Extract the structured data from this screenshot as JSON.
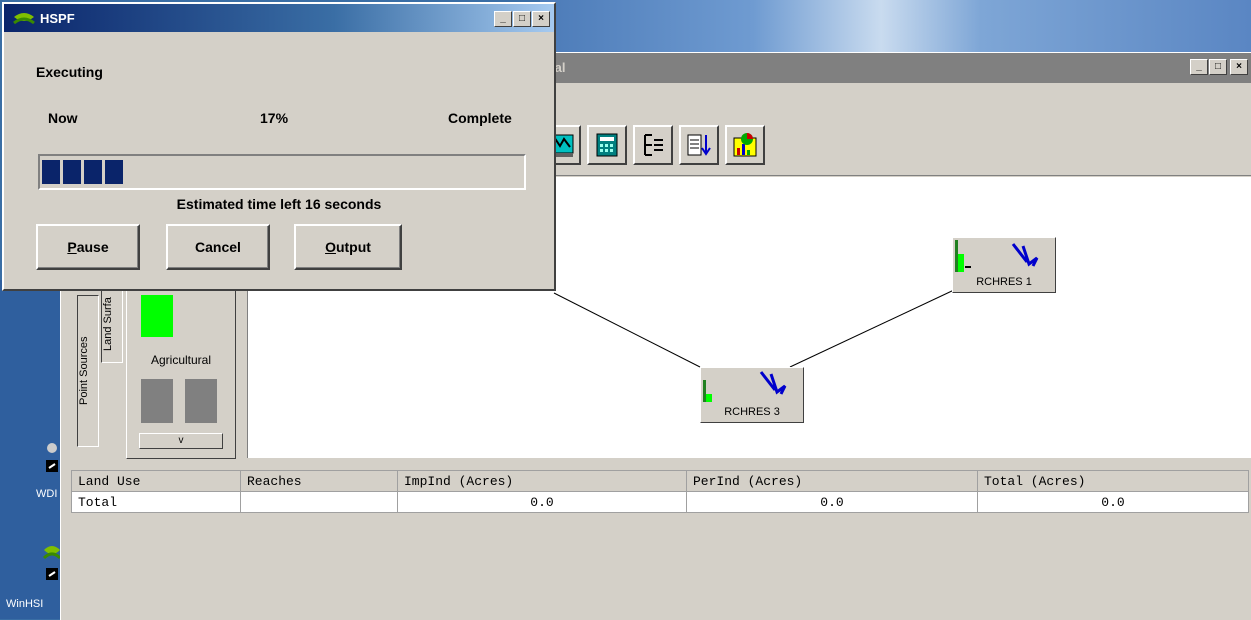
{
  "dialog": {
    "title": "HSPF",
    "status": "Executing",
    "left_label": "Now",
    "percent_text": "17%",
    "right_label": "Complete",
    "progress_fraction": 0.17,
    "eta_text": "Estimated time left 16 seconds",
    "buttons": {
      "pause": "Pause",
      "cancel": "Cancel",
      "output": "Output"
    }
  },
  "main_window": {
    "title_fragment": "ial"
  },
  "palette": {
    "tab_point_sources": "Point Sources",
    "tab_land_surface": "Land Surfa",
    "agricultural_label": "Agricultural",
    "scroll_label": "v"
  },
  "nodes": {
    "reach1": "RCHRES 1",
    "reach3": "RCHRES 3"
  },
  "table": {
    "headers": [
      "Land Use",
      "Reaches",
      "ImpInd (Acres)",
      "PerInd (Acres)",
      "Total (Acres)"
    ],
    "rows": [
      [
        "Total",
        "",
        "0.0",
        "0.0",
        "0.0"
      ]
    ]
  },
  "desktop": {
    "icon1_label": "WDI",
    "icon2_label": "WinHSI"
  },
  "colors": {
    "progress": "#0a246a",
    "land_green": "#00ff00",
    "reach_blue": "#0000cc"
  }
}
